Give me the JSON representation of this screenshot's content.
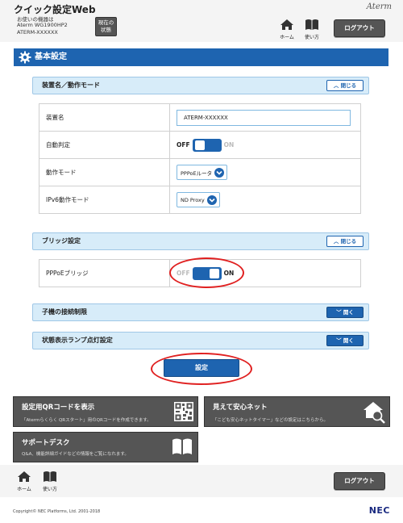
{
  "header": {
    "title": "クイック設定Web",
    "device_label": "お使いの機器は",
    "device_model": "Aterm WG1900HP2",
    "device_name": "ATERM-XXXXXX",
    "status_button_line1": "現在の",
    "status_button_line2": "状態",
    "brand": "Aterm",
    "home_label": "ホーム",
    "help_label": "使い方",
    "logout_label": "ログアウト"
  },
  "main": {
    "title": "基本設定",
    "sections": [
      {
        "title": "装置名／動作モード",
        "toggle_label": "閉じる",
        "state": "open"
      },
      {
        "title": "ブリッジ設定",
        "toggle_label": "閉じる",
        "state": "open"
      },
      {
        "title": "子機の接続制限",
        "toggle_label": "開く",
        "state": "closed"
      },
      {
        "title": "状態表示ランプ点灯設定",
        "toggle_label": "開く",
        "state": "closed"
      }
    ],
    "device_table": [
      {
        "label": "装置名",
        "value": "ATERM-XXXXXX"
      },
      {
        "label": "自動判定",
        "off": "OFF",
        "on": "ON",
        "value": "OFF"
      },
      {
        "label": "動作モード",
        "value": "PPPoEルータ"
      },
      {
        "label": "IPv6動作モード",
        "value": "ND Proxy"
      }
    ],
    "bridge_table": [
      {
        "label": "PPPoEブリッジ",
        "off": "OFF",
        "on": "ON",
        "value": "ON"
      }
    ],
    "submit_label": "設定"
  },
  "tiles": [
    {
      "title": "設定用QRコードを表示",
      "desc": "「Atermらくらく QRスタート」用のQRコードを作成できます。",
      "icon": "qr-code-icon"
    },
    {
      "title": "見えて安心ネット",
      "desc": "「こども安心ネットタイマー」などの設定はこちらから。",
      "icon": "house-search-icon"
    },
    {
      "title": "サポートデスク",
      "desc": "Q&A、機能詳細ガイドなどの情報をご覧になれます。",
      "icon": "book-icon"
    }
  ],
  "footer": {
    "home_label": "ホーム",
    "help_label": "使い方",
    "logout_label": "ログアウト",
    "copyright": "Copyright© NEC Platforms, Ltd. 2001-2018",
    "logo": "NEC"
  },
  "colors": {
    "accent": "#1e64b0",
    "section_bg": "#d7ecf9",
    "dark_button": "#555555",
    "highlight": "#e02020"
  }
}
